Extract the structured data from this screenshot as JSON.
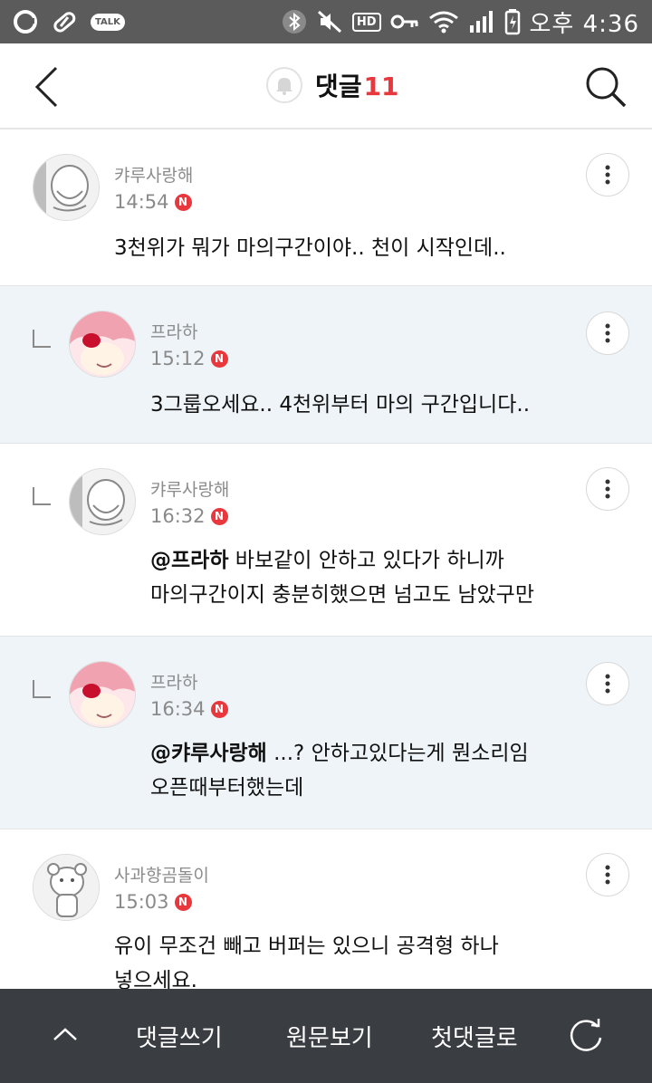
{
  "status_bar": {
    "talk_label": "TALK",
    "hd_label": "HD",
    "time": "오후 4:36"
  },
  "header": {
    "title": "댓글",
    "count": "11"
  },
  "comments": [
    {
      "nickname": "캬루사랑해",
      "time": "14:54",
      "badge": "N",
      "line1": "3천위가 뭐가 마의구간이야.. 천이 시작인데..",
      "mention": "",
      "line2": ""
    },
    {
      "nickname": "프라하",
      "time": "15:12",
      "badge": "N",
      "line1": "3그룹오세요.. 4천위부터 마의 구간입니다..",
      "mention": "",
      "line2": ""
    },
    {
      "nickname": "캬루사랑해",
      "time": "16:32",
      "badge": "N",
      "mention": "@프라하",
      "line1": " 바보같이 안하고 있다가 하니까",
      "line2": "마의구간이지 충분히했으면 넘고도 남았구만"
    },
    {
      "nickname": "프라하",
      "time": "16:34",
      "badge": "N",
      "mention": "@캬루사랑해",
      "line1": " ...? 안하고있다는게 뭔소리임",
      "line2": "오픈때부터했는데"
    },
    {
      "nickname": "사과향곰돌이",
      "time": "15:03",
      "badge": "N",
      "line1": "유이 무조건 빼고 버퍼는 있으니 공격형 하나",
      "mention": "",
      "line2": "넣으세요."
    }
  ],
  "bottom_bar": {
    "write_label": "댓글쓰기",
    "original_label": "원문보기",
    "first_label": "첫댓글로"
  }
}
